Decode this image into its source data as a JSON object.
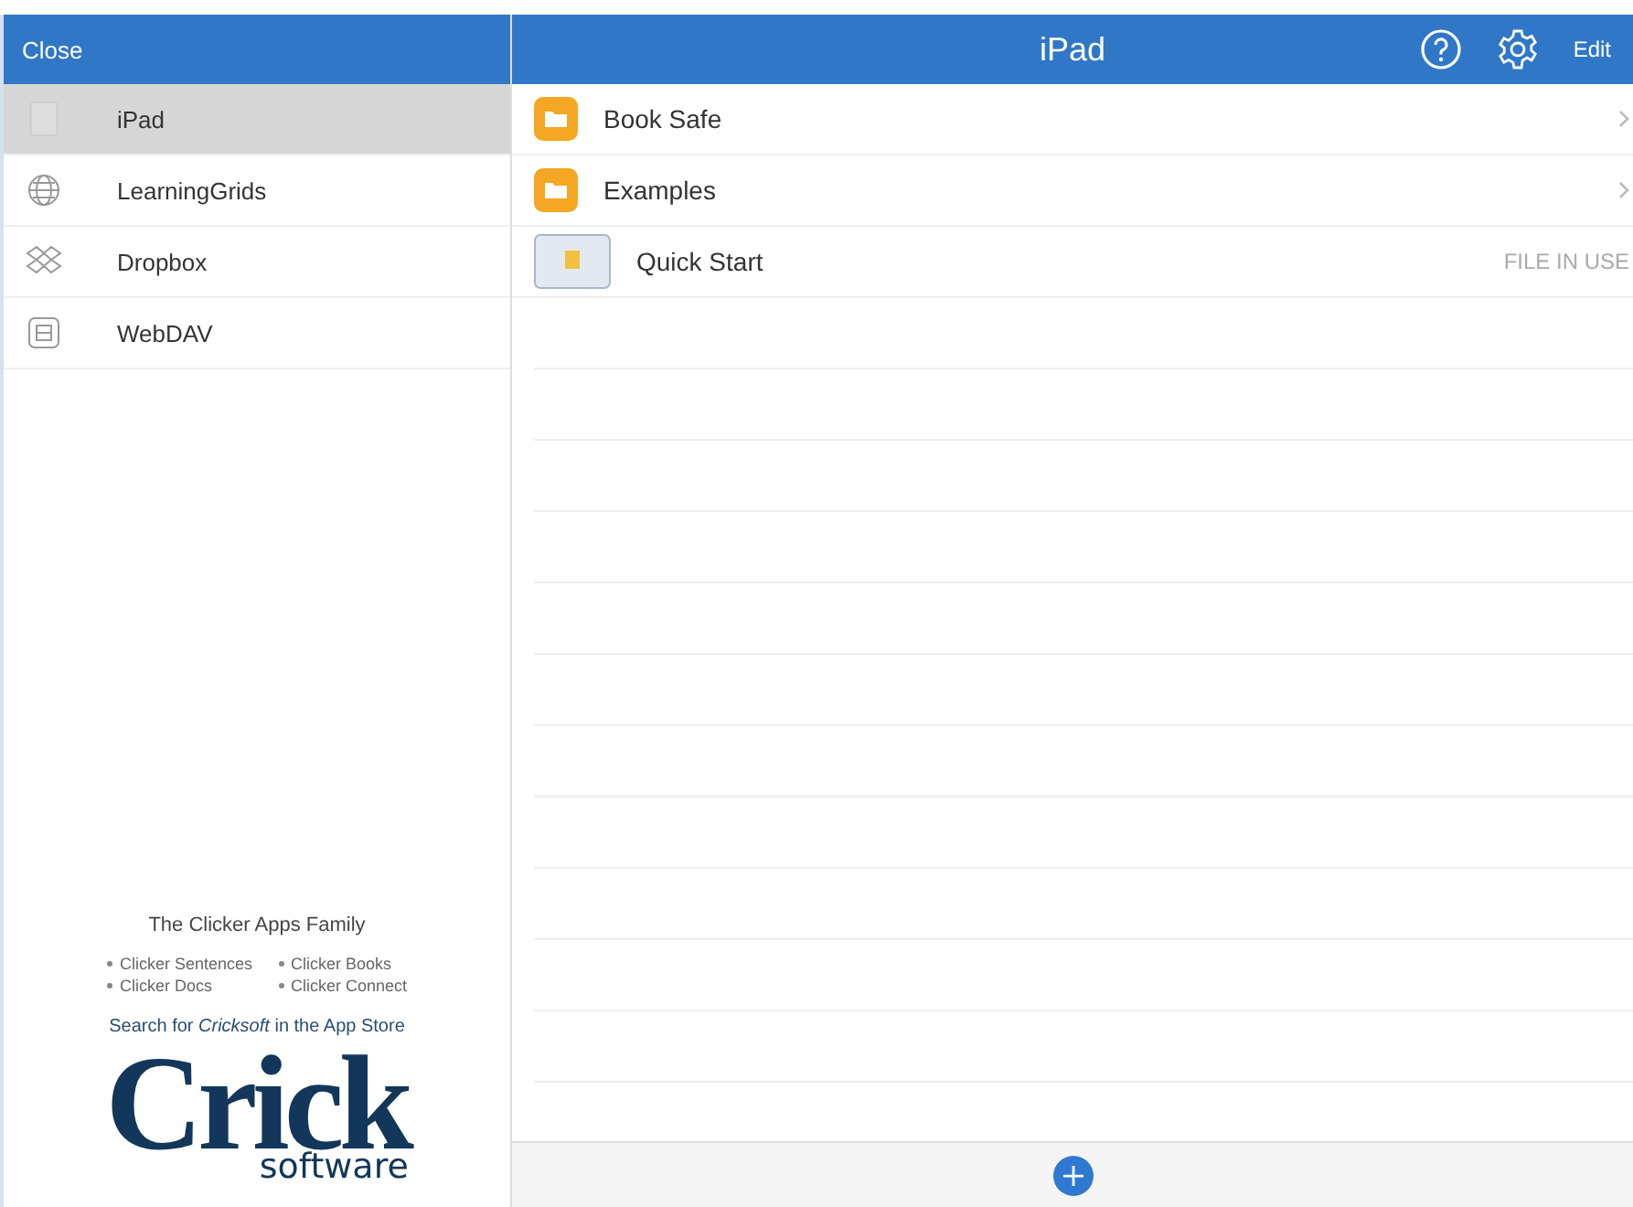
{
  "sidebar": {
    "close_button": "Close",
    "items": [
      {
        "label": "iPad",
        "kind": "tablet",
        "selected": true
      },
      {
        "label": "LearningGrids",
        "kind": "globe",
        "selected": false
      },
      {
        "label": "Dropbox",
        "kind": "dropbox",
        "selected": false
      },
      {
        "label": "WebDAV",
        "kind": "drive",
        "selected": false
      }
    ],
    "promo": {
      "title": "The Clicker Apps Family",
      "apps": [
        "Clicker Sentences",
        "Clicker Books",
        "Clicker Docs",
        "Clicker Connect"
      ],
      "search_text": "Search for *Cricksoft* in the App Store",
      "logo_word": "Crick",
      "logo_sub": "software"
    }
  },
  "main": {
    "title": "iPad",
    "edit_button": "Edit",
    "files": [
      {
        "name": "Book Safe",
        "kind": "folder"
      },
      {
        "name": "Examples",
        "kind": "folder"
      },
      {
        "name": "Quick Start",
        "kind": "document",
        "status": "FILE IN USE"
      }
    ]
  }
}
